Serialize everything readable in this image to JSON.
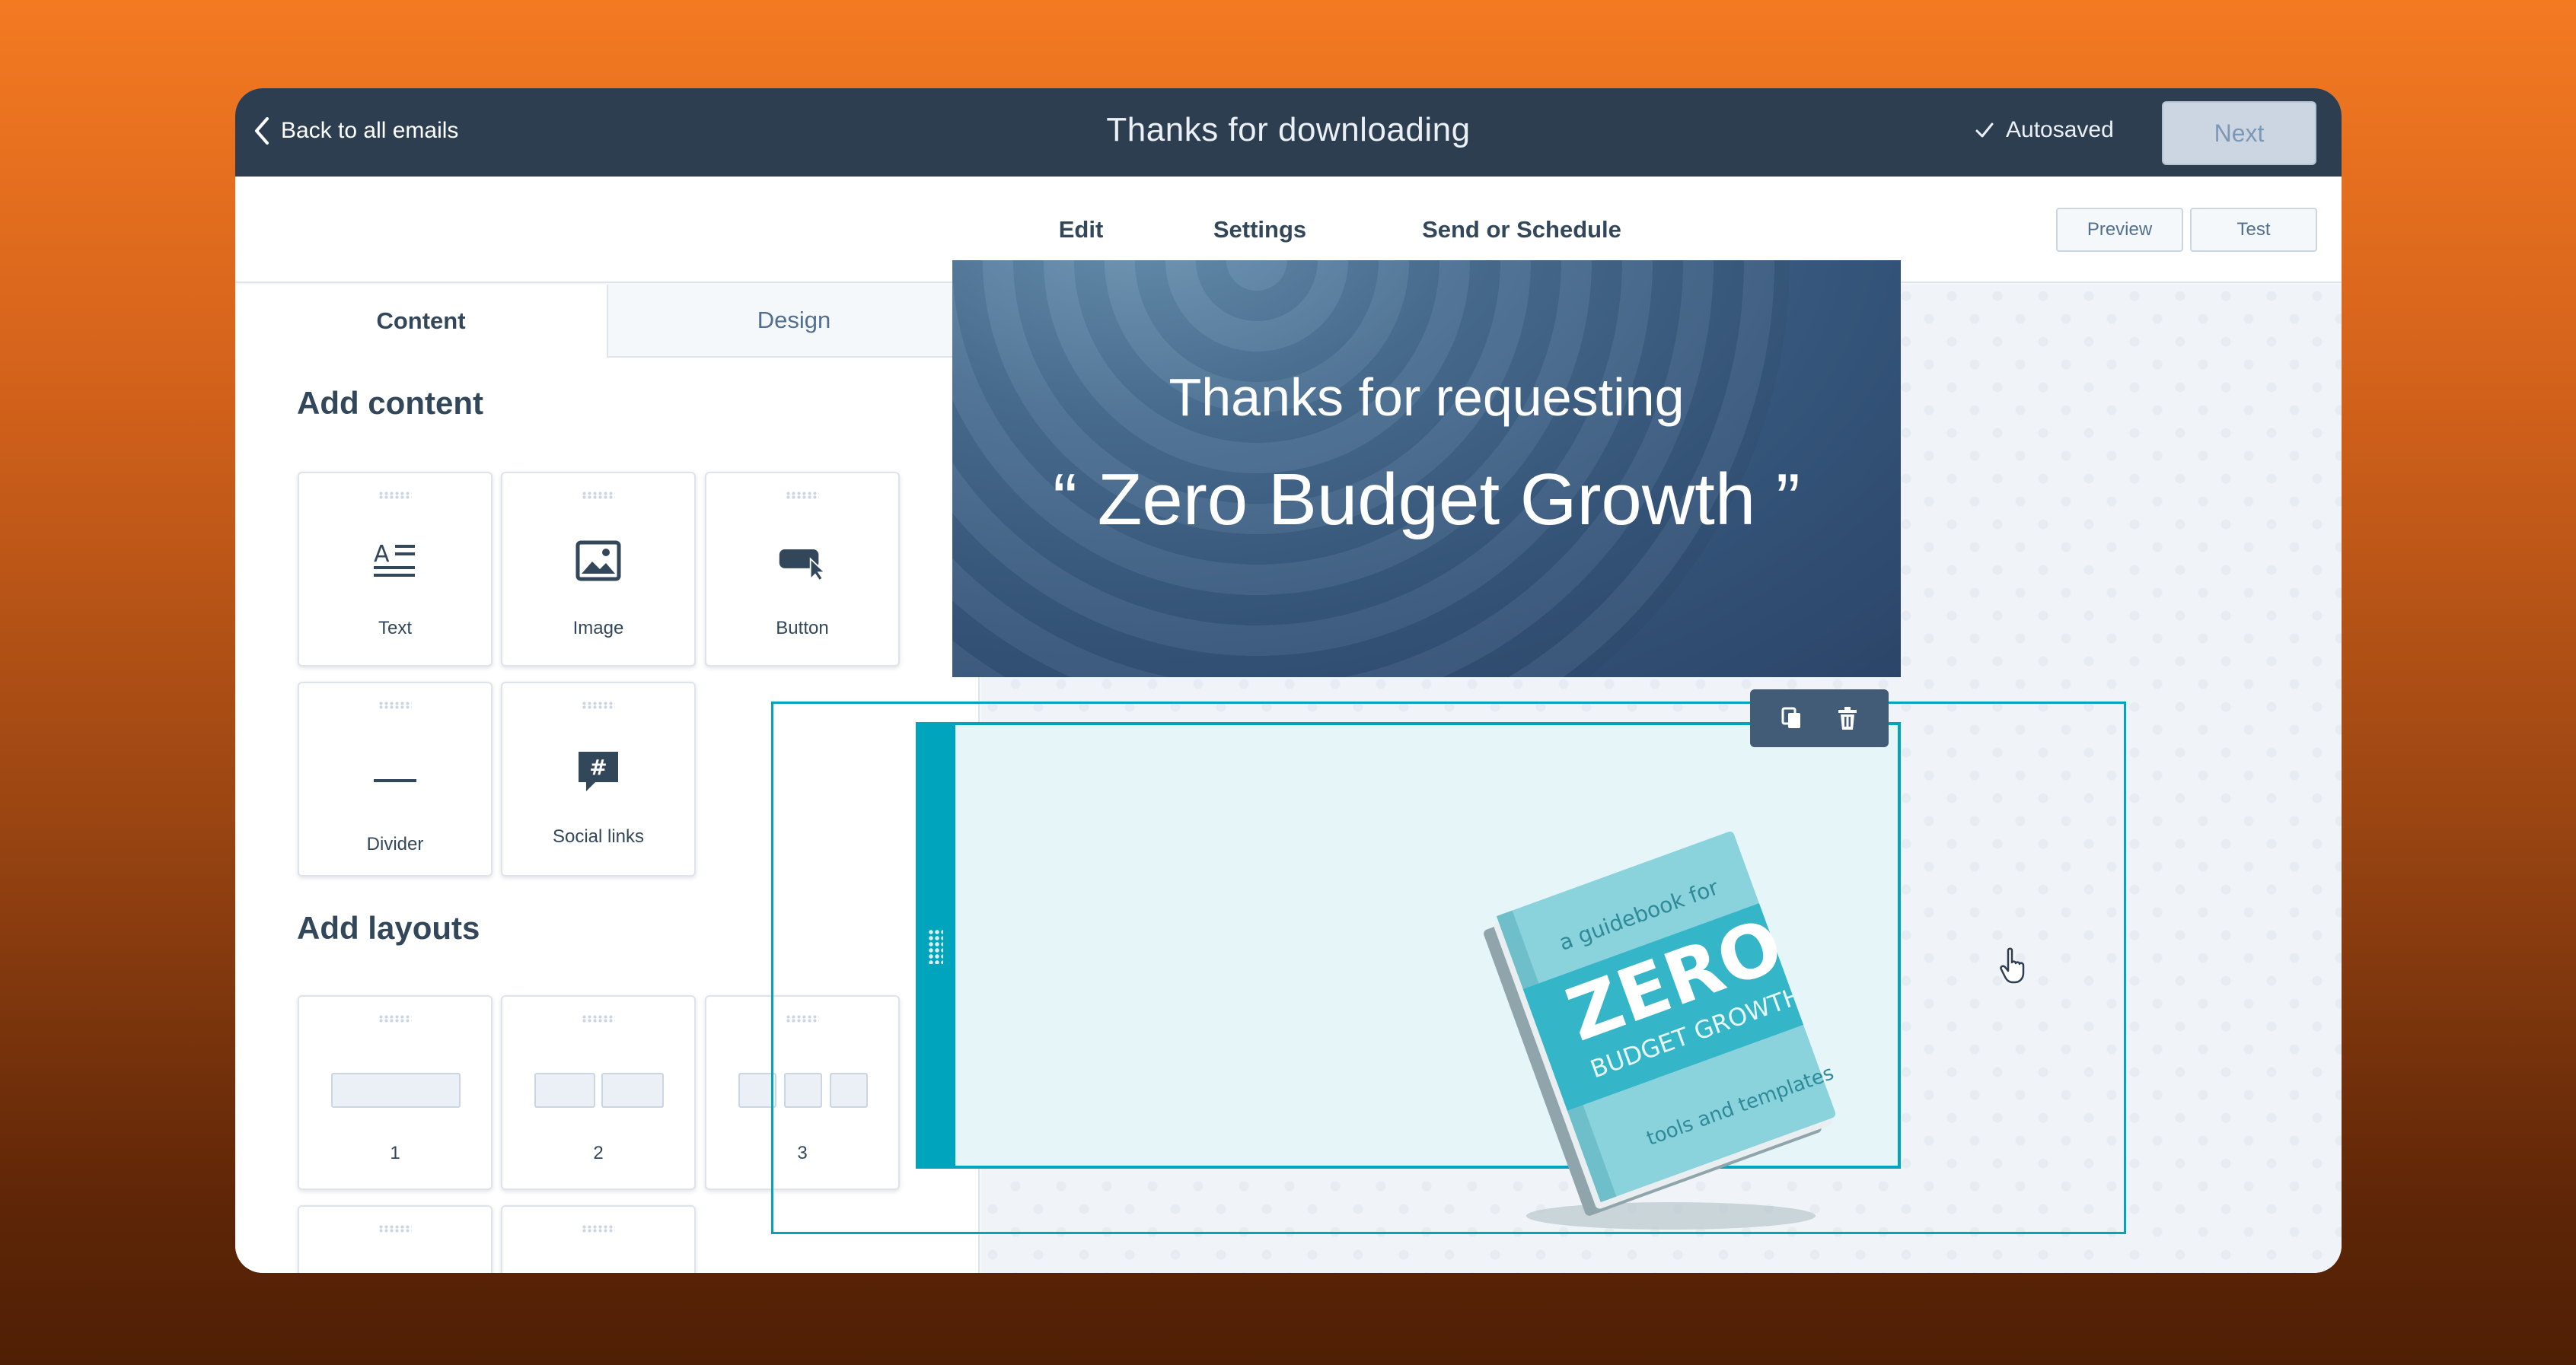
{
  "topbar": {
    "back_label": "Back to all emails",
    "title": "Thanks for downloading",
    "autosaved_label": "Autosaved",
    "next_label": "Next"
  },
  "tabs": [
    {
      "label": "Edit",
      "active": true
    },
    {
      "label": "Settings",
      "active": false
    },
    {
      "label": "Send or Schedule",
      "active": false
    }
  ],
  "actions": {
    "preview_label": "Preview",
    "test_label": "Test"
  },
  "panel": {
    "tabs": [
      {
        "label": "Content",
        "active": true
      },
      {
        "label": "Design",
        "active": false
      }
    ],
    "add_content_heading": "Add content",
    "content_items": [
      {
        "label": "Text",
        "icon": "text-icon"
      },
      {
        "label": "Image",
        "icon": "image-icon"
      },
      {
        "label": "Button",
        "icon": "button-icon"
      },
      {
        "label": "Divider",
        "icon": "divider-icon"
      },
      {
        "label": "Social links",
        "icon": "social-links-icon"
      }
    ],
    "add_layouts_heading": "Add layouts",
    "layouts": [
      {
        "label": "1",
        "columns": 1
      },
      {
        "label": "2",
        "columns": 2
      },
      {
        "label": "3",
        "columns": 3
      }
    ]
  },
  "email": {
    "hero_line1": "Thanks for requesting",
    "hero_line2": "“ Zero Budget Growth ”",
    "book": {
      "tagline": "a guidebook for",
      "title": "ZERO",
      "subtitle": "BUDGET GROWTH",
      "footer": "tools and templates"
    }
  },
  "colors": {
    "topbar": "#2d3e50",
    "accent": "#00a4bd",
    "text": "#33475b"
  }
}
